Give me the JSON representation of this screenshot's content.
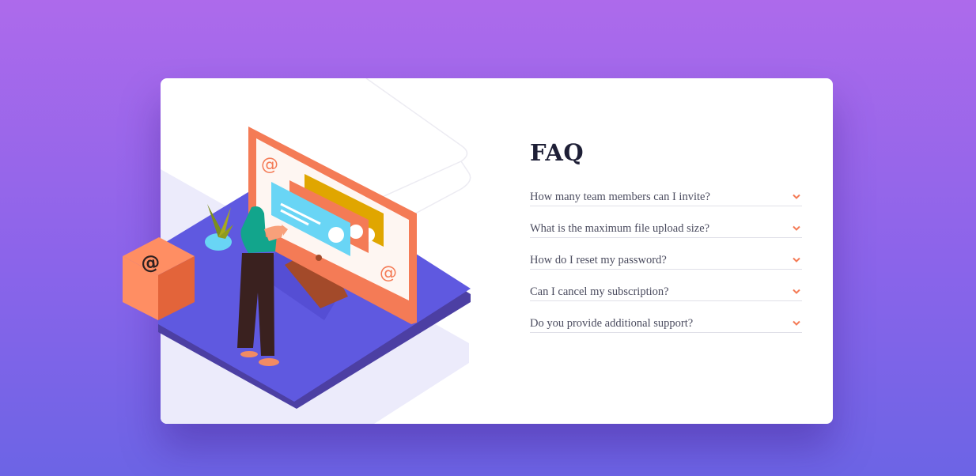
{
  "faq": {
    "title": "FAQ",
    "questions": [
      "How many team members can I invite?",
      "What is the maximum file upload size?",
      "How do I reset my password?",
      "Can I cancel my subscription?",
      "Do you provide additional support?"
    ]
  },
  "colors": {
    "accent": "#f47b56",
    "title": "#1e1f36",
    "question": "#4b4c5f",
    "divider": "#e0e0e8",
    "card": "#ffffff"
  },
  "icons": [
    "chevron-down-icon",
    "at-sign-icon"
  ]
}
